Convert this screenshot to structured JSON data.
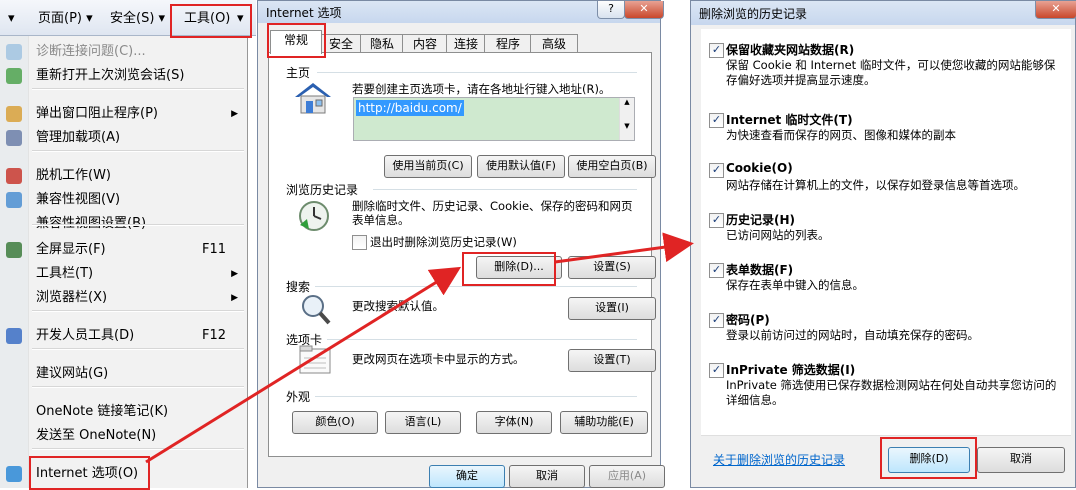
{
  "toolbar": {
    "left_arrow": "▾",
    "page": "页面(P) ▾",
    "safety": "安全(S) ▾",
    "tools": "工具(O)",
    "tools_arrow": "▾"
  },
  "tools_menu": {
    "items": [
      {
        "label": "诊断连接问题(C)...",
        "shortcut": "",
        "submenu": false,
        "icon": "diagnose-icon",
        "disabled": true
      },
      {
        "label": "重新打开上次浏览会话(S)",
        "shortcut": "",
        "submenu": false,
        "icon": "reopen-session-icon"
      },
      {
        "label": "弹出窗口阻止程序(P)",
        "shortcut": "",
        "submenu": true,
        "icon": "popup-blocker-icon"
      },
      {
        "label": "管理加载项(A)",
        "shortcut": "",
        "submenu": false,
        "icon": "addons-icon"
      },
      {
        "label": "脱机工作(W)",
        "shortcut": "",
        "submenu": false,
        "icon": "offline-icon"
      },
      {
        "label": "兼容性视图(V)",
        "shortcut": "",
        "submenu": false,
        "icon": "compat-view-icon"
      },
      {
        "label": "兼容性视图设置(B)",
        "shortcut": "",
        "submenu": false,
        "icon": ""
      },
      {
        "label": "全屏显示(F)",
        "shortcut": "F11",
        "submenu": false,
        "icon": "fullscreen-icon"
      },
      {
        "label": "工具栏(T)",
        "shortcut": "",
        "submenu": true,
        "icon": ""
      },
      {
        "label": "浏览器栏(X)",
        "shortcut": "",
        "submenu": true,
        "icon": ""
      },
      {
        "label": "开发人员工具(D)",
        "shortcut": "F12",
        "submenu": false,
        "icon": "dev-tools-icon"
      },
      {
        "label": "建议网站(G)",
        "shortcut": "",
        "submenu": false,
        "icon": ""
      },
      {
        "label": "OneNote 链接笔记(K)",
        "shortcut": "",
        "submenu": false,
        "icon": ""
      },
      {
        "label": "发送至 OneNote(N)",
        "shortcut": "",
        "submenu": false,
        "icon": ""
      },
      {
        "label": "Internet 选项(O)",
        "shortcut": "",
        "submenu": false,
        "icon": "internet-options-icon"
      }
    ]
  },
  "internet_options": {
    "title": "Internet 选项",
    "help_btn": "?",
    "close_btn": "✕",
    "tabs": [
      "常规",
      "安全",
      "隐私",
      "内容",
      "连接",
      "程序",
      "高级"
    ],
    "home": {
      "group": "主页",
      "desc": "若要创建主页选项卡，请在各地址行键入地址(R)。",
      "url": "http://baidu.com/",
      "btn_current": "使用当前页(C)",
      "btn_default": "使用默认值(F)",
      "btn_blank": "使用空白页(B)"
    },
    "history": {
      "group": "浏览历史记录",
      "desc": "删除临时文件、历史记录、Cookie、保存的密码和网页表单信息。",
      "checkbox_label": "退出时删除浏览历史记录(W)",
      "checkbox_checked": false,
      "btn_delete": "删除(D)...",
      "btn_settings": "设置(S)"
    },
    "search": {
      "group": "搜索",
      "desc": "更改搜索默认值。",
      "btn_settings": "设置(I)"
    },
    "tabs_group": {
      "group": "选项卡",
      "desc": "更改网页在选项卡中显示的方式。",
      "btn_settings": "设置(T)"
    },
    "appearance": {
      "group": "外观",
      "btn_colors": "颜色(O)",
      "btn_languages": "语言(L)",
      "btn_fonts": "字体(N)",
      "btn_accessibility": "辅助功能(E)"
    },
    "footer": {
      "ok": "确定",
      "cancel": "取消",
      "apply": "应用(A)"
    }
  },
  "delete_history": {
    "title": "删除浏览的历史记录",
    "close_btn": "✕",
    "options": [
      {
        "title": "保留收藏夹网站数据(R)",
        "desc": "保留 Cookie 和 Internet 临时文件，可以使您收藏的网站能够保存偏好选项并提高显示速度。",
        "checked": true
      },
      {
        "title": "Internet 临时文件(T)",
        "desc": "为快速查看而保存的网页、图像和媒体的副本",
        "checked": true
      },
      {
        "title": "Cookie(O)",
        "desc": "网站存储在计算机上的文件，以保存如登录信息等首选项。",
        "checked": true
      },
      {
        "title": "历史记录(H)",
        "desc": "已访问网站的列表。",
        "checked": true
      },
      {
        "title": "表单数据(F)",
        "desc": "保存在表单中键入的信息。",
        "checked": true
      },
      {
        "title": "密码(P)",
        "desc": "登录以前访问过的网站时，自动填充保存的密码。",
        "checked": true
      },
      {
        "title": "InPrivate 筛选数据(I)",
        "desc": "InPrivate 筛选使用已保存数据检测网站在何处自动共享您访问的详细信息。",
        "checked": true
      }
    ],
    "about_link": "关于删除浏览的历史记录",
    "btn_delete": "删除(D)",
    "btn_cancel": "取消"
  },
  "colors": {
    "annotation": "#e02424",
    "selection": "#3399ff",
    "link": "#0066cc"
  }
}
